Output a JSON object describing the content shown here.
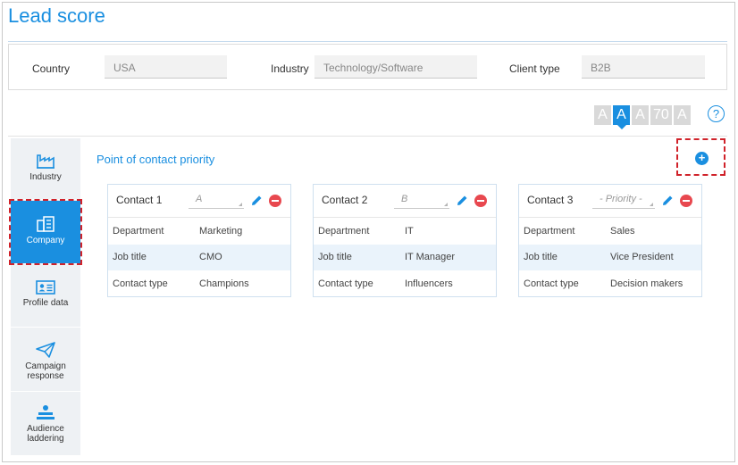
{
  "page": {
    "title": "Lead score"
  },
  "filters": {
    "country_label": "Country",
    "country_value": "USA",
    "industry_label": "Industry",
    "industry_value": "Technology/Software",
    "client_type_label": "Client type",
    "client_type_value": "B2B"
  },
  "scores": [
    {
      "label": "A",
      "active": false
    },
    {
      "label": "A",
      "active": true
    },
    {
      "label": "A",
      "active": false
    },
    {
      "label": "70",
      "active": false
    },
    {
      "label": "A",
      "active": false
    }
  ],
  "help_label": "?",
  "sidebar": {
    "items": [
      {
        "label": "Industry",
        "icon": "factory-icon"
      },
      {
        "label": "Company",
        "icon": "building-icon",
        "active": true
      },
      {
        "label": "Profile data",
        "icon": "id-card-icon"
      },
      {
        "label": "Campaign response",
        "icon": "paper-plane-icon"
      },
      {
        "label": "Audience laddering",
        "icon": "people-stack-icon"
      }
    ]
  },
  "section": {
    "title": "Point of contact priority",
    "add_label": "+"
  },
  "contacts": [
    {
      "name": "Contact 1",
      "priority": "A",
      "rows": [
        {
          "key": "Department",
          "value": "Marketing"
        },
        {
          "key": "Job title",
          "value": "CMO"
        },
        {
          "key": "Contact type",
          "value": "Champions"
        }
      ]
    },
    {
      "name": "Contact 2",
      "priority": "B",
      "rows": [
        {
          "key": "Department",
          "value": "IT"
        },
        {
          "key": "Job title",
          "value": "IT Manager"
        },
        {
          "key": "Contact type",
          "value": "Influencers"
        }
      ]
    },
    {
      "name": "Contact 3",
      "priority": "- Priority -",
      "rows": [
        {
          "key": "Department",
          "value": "Sales"
        },
        {
          "key": "Job title",
          "value": "Vice President"
        },
        {
          "key": "Contact type",
          "value": "Decision makers"
        }
      ]
    }
  ],
  "colors": {
    "accent": "#1a8fe0",
    "danger": "#e8484f",
    "highlight_border": "#d0222a"
  }
}
